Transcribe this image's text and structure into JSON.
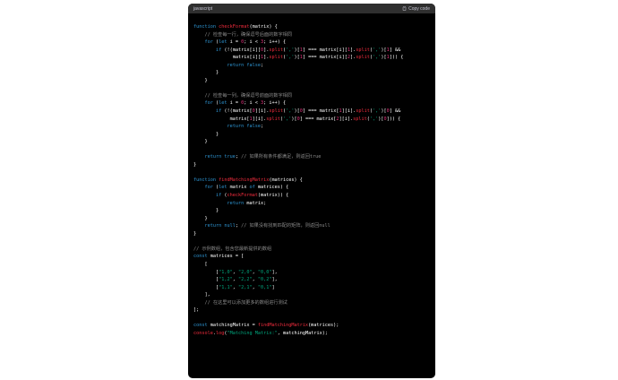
{
  "header": {
    "language": "javascript",
    "copy_label": "Copy code",
    "copy_icon": "clipboard-icon"
  },
  "colors": {
    "keyword": "#2e95d3",
    "function": "#f22c3d",
    "string": "#00a67d",
    "number": "#df3079",
    "comment": "#8a8a8a",
    "text": "#ffffff",
    "background": "#000000",
    "header_bg": "#2f2f2f"
  },
  "code_lines": [
    [
      [
        "kw",
        "function "
      ],
      [
        "fn",
        "checkFormat"
      ],
      [
        "tx",
        "(matrix) {"
      ]
    ],
    [
      [
        "tx",
        "    "
      ],
      [
        "cm",
        "// 检查每一行，确保逗号后面的数字相同"
      ]
    ],
    [
      [
        "tx",
        "    "
      ],
      [
        "kw",
        "for"
      ],
      [
        "tx",
        " ("
      ],
      [
        "kw",
        "let"
      ],
      [
        "tx",
        " i = "
      ],
      [
        "num",
        "0"
      ],
      [
        "tx",
        "; i < "
      ],
      [
        "num",
        "3"
      ],
      [
        "tx",
        "; i++) {"
      ]
    ],
    [
      [
        "tx",
        "        "
      ],
      [
        "kw",
        "if"
      ],
      [
        "tx",
        " (!(matrix[i]["
      ],
      [
        "num",
        "0"
      ],
      [
        "tx",
        "]."
      ],
      [
        "fn",
        "split"
      ],
      [
        "tx",
        "("
      ],
      [
        "str",
        "','"
      ],
      [
        "tx",
        ")["
      ],
      [
        "num",
        "1"
      ],
      [
        "tx",
        "] === matrix[i]["
      ],
      [
        "num",
        "1"
      ],
      [
        "tx",
        "]."
      ],
      [
        "fn",
        "split"
      ],
      [
        "tx",
        "("
      ],
      [
        "str",
        "','"
      ],
      [
        "tx",
        ")["
      ],
      [
        "num",
        "1"
      ],
      [
        "tx",
        "] &&"
      ]
    ],
    [
      [
        "tx",
        "              matrix[i]["
      ],
      [
        "num",
        "1"
      ],
      [
        "tx",
        "]."
      ],
      [
        "fn",
        "split"
      ],
      [
        "tx",
        "("
      ],
      [
        "str",
        "','"
      ],
      [
        "tx",
        ")["
      ],
      [
        "num",
        "1"
      ],
      [
        "tx",
        "] === matrix[i]["
      ],
      [
        "num",
        "2"
      ],
      [
        "tx",
        "]."
      ],
      [
        "fn",
        "split"
      ],
      [
        "tx",
        "("
      ],
      [
        "str",
        "','"
      ],
      [
        "tx",
        ")["
      ],
      [
        "num",
        "1"
      ],
      [
        "tx",
        "])) {"
      ]
    ],
    [
      [
        "tx",
        "            "
      ],
      [
        "kw",
        "return"
      ],
      [
        "tx",
        " "
      ],
      [
        "kw",
        "false"
      ],
      [
        "tx",
        ";"
      ]
    ],
    [
      [
        "tx",
        "        }"
      ]
    ],
    [
      [
        "tx",
        "    }"
      ]
    ],
    [],
    [
      [
        "tx",
        "    "
      ],
      [
        "cm",
        "// 检查每一列，确保逗号前面的数字相同"
      ]
    ],
    [
      [
        "tx",
        "    "
      ],
      [
        "kw",
        "for"
      ],
      [
        "tx",
        " ("
      ],
      [
        "kw",
        "let"
      ],
      [
        "tx",
        " i = "
      ],
      [
        "num",
        "0"
      ],
      [
        "tx",
        "; i < "
      ],
      [
        "num",
        "3"
      ],
      [
        "tx",
        "; i++) {"
      ]
    ],
    [
      [
        "tx",
        "        "
      ],
      [
        "kw",
        "if"
      ],
      [
        "tx",
        " (!(matrix["
      ],
      [
        "num",
        "0"
      ],
      [
        "tx",
        "][i]."
      ],
      [
        "fn",
        "split"
      ],
      [
        "tx",
        "("
      ],
      [
        "str",
        "','"
      ],
      [
        "tx",
        ")["
      ],
      [
        "num",
        "0"
      ],
      [
        "tx",
        "] === matrix["
      ],
      [
        "num",
        "1"
      ],
      [
        "tx",
        "][i]."
      ],
      [
        "fn",
        "split"
      ],
      [
        "tx",
        "("
      ],
      [
        "str",
        "','"
      ],
      [
        "tx",
        ")["
      ],
      [
        "num",
        "0"
      ],
      [
        "tx",
        "] &&"
      ]
    ],
    [
      [
        "tx",
        "             matrix["
      ],
      [
        "num",
        "1"
      ],
      [
        "tx",
        "][i]."
      ],
      [
        "fn",
        "split"
      ],
      [
        "tx",
        "("
      ],
      [
        "str",
        "','"
      ],
      [
        "tx",
        ")["
      ],
      [
        "num",
        "0"
      ],
      [
        "tx",
        "] === matrix["
      ],
      [
        "num",
        "2"
      ],
      [
        "tx",
        "][i]."
      ],
      [
        "fn",
        "split"
      ],
      [
        "tx",
        "("
      ],
      [
        "str",
        "','"
      ],
      [
        "tx",
        ")["
      ],
      [
        "num",
        "0"
      ],
      [
        "tx",
        "])) {"
      ]
    ],
    [
      [
        "tx",
        "            "
      ],
      [
        "kw",
        "return"
      ],
      [
        "tx",
        " "
      ],
      [
        "kw",
        "false"
      ],
      [
        "tx",
        ";"
      ]
    ],
    [
      [
        "tx",
        "        }"
      ]
    ],
    [
      [
        "tx",
        "    }"
      ]
    ],
    [],
    [
      [
        "tx",
        "    "
      ],
      [
        "kw",
        "return"
      ],
      [
        "tx",
        " "
      ],
      [
        "kw",
        "true"
      ],
      [
        "tx",
        "; "
      ],
      [
        "cm",
        "// 如果所有条件都满足，则返回true"
      ]
    ],
    [
      [
        "tx",
        "}"
      ]
    ],
    [],
    [
      [
        "kw",
        "function "
      ],
      [
        "fn",
        "findMatchingMatrix"
      ],
      [
        "tx",
        "(matrices) {"
      ]
    ],
    [
      [
        "tx",
        "    "
      ],
      [
        "kw",
        "for"
      ],
      [
        "tx",
        " ("
      ],
      [
        "kw",
        "let"
      ],
      [
        "tx",
        " matrix "
      ],
      [
        "kw",
        "of"
      ],
      [
        "tx",
        " matrices) {"
      ]
    ],
    [
      [
        "tx",
        "        "
      ],
      [
        "kw",
        "if"
      ],
      [
        "tx",
        " ("
      ],
      [
        "fn",
        "checkFormat"
      ],
      [
        "tx",
        "(matrix)) {"
      ]
    ],
    [
      [
        "tx",
        "            "
      ],
      [
        "kw",
        "return"
      ],
      [
        "tx",
        " matrix;"
      ]
    ],
    [
      [
        "tx",
        "        }"
      ]
    ],
    [
      [
        "tx",
        "    }"
      ]
    ],
    [
      [
        "tx",
        "    "
      ],
      [
        "kw",
        "return"
      ],
      [
        "tx",
        " "
      ],
      [
        "kw",
        "null"
      ],
      [
        "tx",
        "; "
      ],
      [
        "cm",
        "// 如果没有找到匹配的矩阵，则返回null"
      ]
    ],
    [
      [
        "tx",
        "}"
      ]
    ],
    [],
    [
      [
        "cm",
        "// 示例数组，包含您最新提供的数组"
      ]
    ],
    [
      [
        "kw",
        "const"
      ],
      [
        "tx",
        " matrices = ["
      ]
    ],
    [
      [
        "tx",
        "    ["
      ]
    ],
    [
      [
        "tx",
        "        ["
      ],
      [
        "str",
        "\"1,0\""
      ],
      [
        "tx",
        ", "
      ],
      [
        "str",
        "\"2,0\""
      ],
      [
        "tx",
        ", "
      ],
      [
        "str",
        "\"0,0\""
      ],
      [
        "tx",
        "],"
      ]
    ],
    [
      [
        "tx",
        "        ["
      ],
      [
        "str",
        "\"1,2\""
      ],
      [
        "tx",
        ", "
      ],
      [
        "str",
        "\"2,2\""
      ],
      [
        "tx",
        ", "
      ],
      [
        "str",
        "\"0,2\""
      ],
      [
        "tx",
        "],"
      ]
    ],
    [
      [
        "tx",
        "        ["
      ],
      [
        "str",
        "\"1,1\""
      ],
      [
        "tx",
        ", "
      ],
      [
        "str",
        "\"2,1\""
      ],
      [
        "tx",
        ", "
      ],
      [
        "str",
        "\"0,1\""
      ],
      [
        "tx",
        "]"
      ]
    ],
    [
      [
        "tx",
        "    ],"
      ]
    ],
    [
      [
        "tx",
        "    "
      ],
      [
        "cm",
        "// 在这里可以添加更多的数组进行测试"
      ]
    ],
    [
      [
        "tx",
        "];"
      ]
    ],
    [],
    [
      [
        "kw",
        "const"
      ],
      [
        "tx",
        " matchingMatrix = "
      ],
      [
        "fn",
        "findMatchingMatrix"
      ],
      [
        "tx",
        "(matrices);"
      ]
    ],
    [
      [
        "fn",
        "console"
      ],
      [
        "tx",
        "."
      ],
      [
        "fn",
        "log"
      ],
      [
        "tx",
        "("
      ],
      [
        "str",
        "\"Matching Matrix:\""
      ],
      [
        "tx",
        ", matchingMatrix);"
      ]
    ]
  ]
}
